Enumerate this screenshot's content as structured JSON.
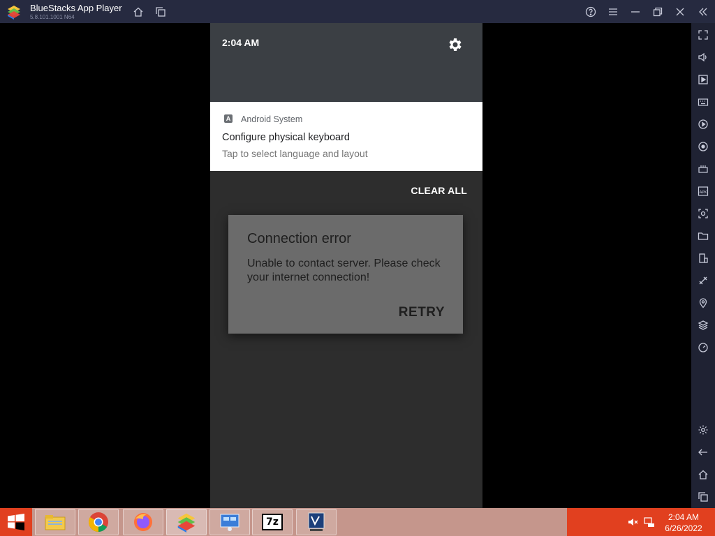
{
  "window": {
    "title": "BlueStacks App Player",
    "version": "5.8.101.1001  N64"
  },
  "android": {
    "status_time": "2:04 AM",
    "notification": {
      "app_icon_letter": "A",
      "app_name": "Android System",
      "title": "Configure physical keyboard",
      "text": "Tap to select language and layout"
    },
    "clear_all_label": "CLEAR ALL",
    "dialog": {
      "title": "Connection error",
      "message": "Unable to contact server. Please check your internet connection!",
      "retry_label": "RETRY"
    }
  },
  "sidebar_icons": [
    "fullscreen-icon",
    "volume-icon",
    "media-icon",
    "keyboard-icon",
    "macro-icon",
    "rotate-sync-icon",
    "controls-icon",
    "apk-icon",
    "screenshot-icon",
    "folder-icon",
    "multi-instance-icon",
    "eco-mode-icon",
    "location-icon",
    "layers-icon",
    "speed-icon",
    "settings-icon",
    "back-icon",
    "home-icon",
    "recents-icon"
  ],
  "taskbar": {
    "apps": [
      "file-explorer-icon",
      "chrome-icon",
      "firefox-icon",
      "bluestacks-icon",
      "network-icon",
      "7zip-icon",
      "virtualbox-icon"
    ],
    "seven_zip_label": "7z",
    "clock_time": "2:04 AM",
    "clock_date": "6/26/2022"
  },
  "colors": {
    "titlebar": "#262a40",
    "accent_taskbar": "#e1401f",
    "dialog_bg": "#6b6b6b"
  }
}
